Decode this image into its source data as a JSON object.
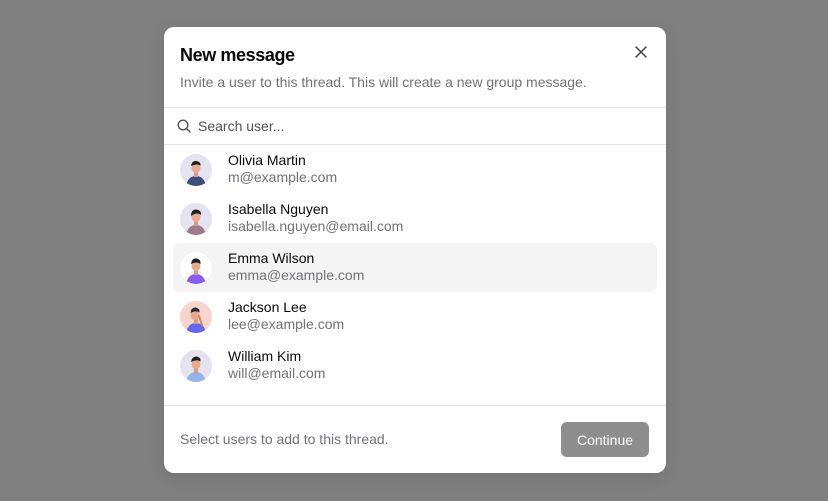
{
  "dialog": {
    "title": "New message",
    "subtitle": "Invite a user to this thread. This will create a new group message."
  },
  "search": {
    "placeholder": "Search user...",
    "value": ""
  },
  "users": [
    {
      "name": "Olivia Martin",
      "email": "m@example.com",
      "avatar_color": "#3b4f7a",
      "selected": false
    },
    {
      "name": "Isabella Nguyen",
      "email": "isabella.nguyen@email.com",
      "avatar_color": "#a07a8a",
      "selected": false
    },
    {
      "name": "Emma Wilson",
      "email": "emma@example.com",
      "avatar_color": "#8b5cf6",
      "selected": true
    },
    {
      "name": "Jackson Lee",
      "email": "lee@example.com",
      "avatar_color": "#6366f1",
      "selected": false
    },
    {
      "name": "William Kim",
      "email": "will@email.com",
      "avatar_color": "#93b4e8",
      "selected": false
    }
  ],
  "footer": {
    "text": "Select users to add to this thread.",
    "continue_label": "Continue"
  },
  "colors": {
    "backdrop": "#808080",
    "button_disabled": "#8e8e8e",
    "selected_row": "#f4f4f5"
  }
}
